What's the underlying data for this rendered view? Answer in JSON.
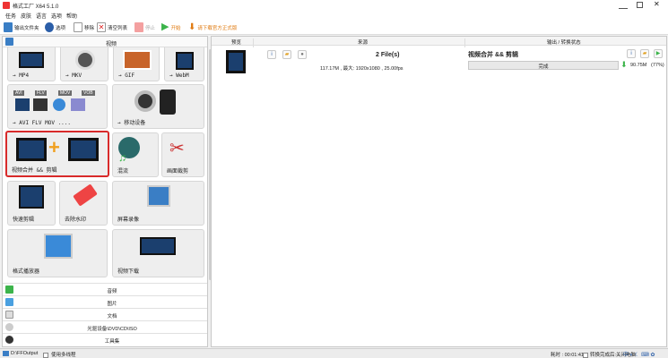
{
  "window": {
    "title": "格式工厂 X64 5.1.0"
  },
  "menu": [
    "任务",
    "皮肤",
    "语言",
    "选项",
    "帮助"
  ],
  "toolbar": {
    "output_folder": "输出文件夹",
    "options": "选项",
    "remove": "移除",
    "clear_list": "清空列表",
    "stop": "停止",
    "start": "开始",
    "download_official": "请下载官方正式版"
  },
  "left": {
    "header": "视频",
    "tiles": [
      {
        "label": "→ MP4"
      },
      {
        "label": "→ MKV"
      },
      {
        "label": "→ GIF"
      },
      {
        "label": "→ WebM"
      },
      {
        "label": "→ AVI FLV MOV ...."
      },
      {
        "label": "→ 移动设备"
      },
      {
        "label": "视频合并 && 剪辑"
      },
      {
        "label": "混流"
      },
      {
        "label": "画面裁剪"
      },
      {
        "label": "快速剪辑"
      },
      {
        "label": "去除水印"
      },
      {
        "label": "屏幕录像"
      },
      {
        "label": "格式播放器"
      },
      {
        "label": "视频下载"
      }
    ],
    "format_badges": [
      "AVI",
      "FLV",
      "MOV",
      "VOB"
    ],
    "categories": [
      "音频",
      "图片",
      "文档",
      "光驱设备\\DVD\\CD\\ISO",
      "工具集"
    ]
  },
  "right": {
    "columns": {
      "preview": "预览",
      "source": "来源",
      "output_status": "输出 / 转换状态"
    },
    "task": {
      "files": "2 File(s)",
      "details": "117.17M , 最大: 1920x1080 , 25.00fps",
      "name": "视频合并 && 剪辑",
      "status": "完成",
      "size": "90.75M",
      "percent": "(77%)"
    }
  },
  "statusbar": {
    "output_path": "D:\\FFOutput",
    "multithread": "使用多线程",
    "elapsed": "耗时 : 00:01:41",
    "after_convert": "转换完成后:关闭电脑"
  },
  "colors": {
    "accent": "#3a7ec5",
    "selection": "#d82a2a",
    "progress": "#3cb44b",
    "stop": "#f4a0a0"
  }
}
